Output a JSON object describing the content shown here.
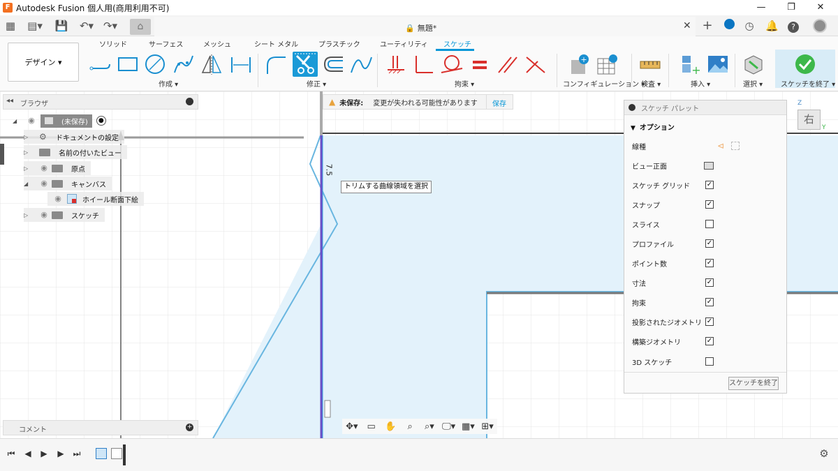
{
  "window": {
    "title": "Autodesk Fusion 個人用(商用利用不可)",
    "logo_letter": "F",
    "controls": [
      "—",
      "❐",
      "✕"
    ]
  },
  "document": {
    "title": "無題*",
    "close_glyph": "✕"
  },
  "design_button": "デザイン ▾",
  "ribbon_tabs": [
    "ソリッド",
    "サーフェス",
    "メッシュ",
    "シート メタル",
    "プラスチック",
    "ユーティリティ",
    "スケッチ"
  ],
  "ribbon_groups": {
    "create": "作成 ▾",
    "modify": "修正 ▾",
    "constraints": "拘束 ▾",
    "configuration": "コンフィギュレーション ▾",
    "inspect": "検査 ▾",
    "insert": "挿入 ▾",
    "select": "選択 ▾",
    "finish": "スケッチを終了 ▾"
  },
  "browser": {
    "title": "ブラウザ",
    "items": [
      {
        "label": "(未保存)"
      },
      {
        "label": "ドキュメントの設定"
      },
      {
        "label": "名前の付いたビュー"
      },
      {
        "label": "原点"
      },
      {
        "label": "キャンバス"
      },
      {
        "label": "ホイール断面下絵"
      },
      {
        "label": "スケッチ"
      }
    ]
  },
  "comments": {
    "title": "コメント"
  },
  "unsaved": {
    "label": "未保存:",
    "message": "変更が失われる可能性があります",
    "save": "保存"
  },
  "canvas": {
    "dimension": "7.5",
    "tooltip": "トリムする曲線領域を選択",
    "viewcube_face": "右",
    "axis_z": "Z",
    "axis_y": "Y"
  },
  "palette": {
    "title": "スケッチ パレット",
    "section": "オプション",
    "rows": [
      {
        "label": "線種",
        "control": "icons"
      },
      {
        "label": "ビュー正面",
        "control": "icon"
      },
      {
        "label": "スケッチ グリッド",
        "control": "checkbox",
        "checked": true
      },
      {
        "label": "スナップ",
        "control": "checkbox",
        "checked": true
      },
      {
        "label": "スライス",
        "control": "checkbox",
        "checked": false
      },
      {
        "label": "プロファイル",
        "control": "checkbox",
        "checked": true
      },
      {
        "label": "ポイント数",
        "control": "checkbox",
        "checked": true
      },
      {
        "label": "寸法",
        "control": "checkbox",
        "checked": true
      },
      {
        "label": "拘束",
        "control": "checkbox",
        "checked": true
      },
      {
        "label": "投影されたジオメトリ",
        "control": "checkbox",
        "checked": true
      },
      {
        "label": "構築ジオメトリ",
        "control": "checkbox",
        "checked": true
      },
      {
        "label": "3D スケッチ",
        "control": "checkbox",
        "checked": false
      }
    ],
    "finish_button": "スケッチを終了"
  },
  "colors": {
    "accent": "#0696d7",
    "finish_green": "#3db84a",
    "constraint_red": "#d9302c",
    "sketch_fill": "#e3f2fb",
    "sketch_line": "#69b6e0"
  }
}
